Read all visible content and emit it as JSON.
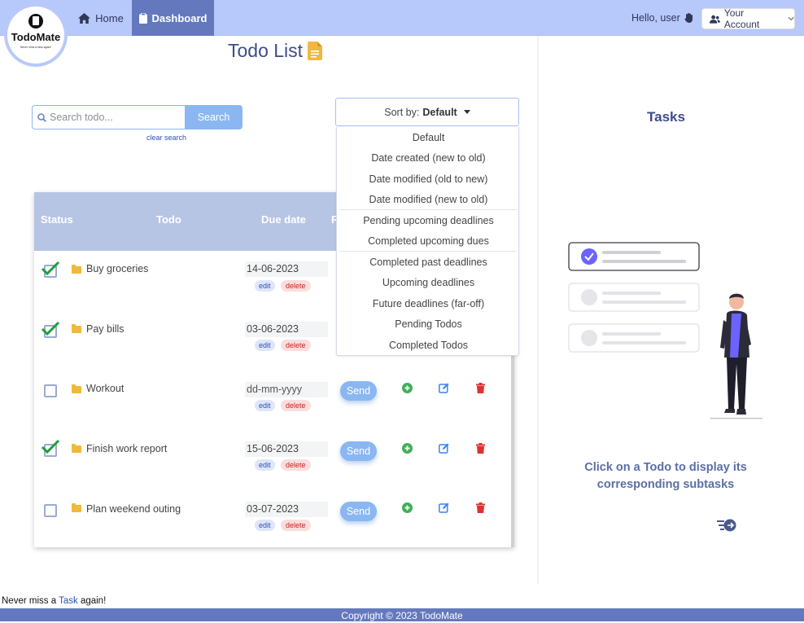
{
  "brand": {
    "name": "TodoMate",
    "tagline": "Never miss a task again!"
  },
  "nav": {
    "home_label": "Home",
    "dashboard_label": "Dashboard",
    "greeting": "Hello, user",
    "account_label": "Your Account"
  },
  "page": {
    "title": "Todo List"
  },
  "search": {
    "placeholder": "Search todo...",
    "button_label": "Search",
    "clear_label": "clear search"
  },
  "sort": {
    "prefix": "Sort by:",
    "selected": "Default",
    "options": [
      "Default",
      "Date created (new to old)",
      "Date modified (old to new)",
      "Date modified (new to old)",
      "Pending upcoming deadlines",
      "Completed upcoming dues",
      "Completed past deadlines",
      "Upcoming deadlines",
      "Future deadlines (far-off)",
      "Pending Todos",
      "Completed Todos"
    ]
  },
  "table": {
    "headers": {
      "status": "Status",
      "todo": "Todo",
      "due": "Due date",
      "reminder_partial": "R"
    },
    "rows": [
      {
        "done": true,
        "text": "Buy groceries",
        "due": "14-06-2023"
      },
      {
        "done": true,
        "text": "Pay bills",
        "due": "03-06-2023"
      },
      {
        "done": false,
        "text": "Workout",
        "due": "dd-mm-yyyy"
      },
      {
        "done": true,
        "text": "Finish work report",
        "due": "15-06-2023"
      },
      {
        "done": false,
        "text": "Plan weekend outing",
        "due": "03-07-2023"
      }
    ],
    "edit_label": "edit",
    "delete_label": "delete",
    "send_label": "Send"
  },
  "right_panel": {
    "title": "Tasks",
    "message": "Click on a Todo to display its corresponding subtasks"
  },
  "footer": {
    "note_before": "Never miss a ",
    "note_link": "Task",
    "note_after": " again!",
    "copyright": "Copyright © 2023 TodoMate"
  },
  "colors": {
    "navbar": "#b7c8fb",
    "dashboard_active": "#6479bd",
    "accent_blue": "#8ab7f1",
    "folder": "#efb93a",
    "check_green": "#1e9e3a",
    "add_green": "#3fae5a",
    "edit_blue": "#3c82f0",
    "delete_red": "#e03030"
  }
}
